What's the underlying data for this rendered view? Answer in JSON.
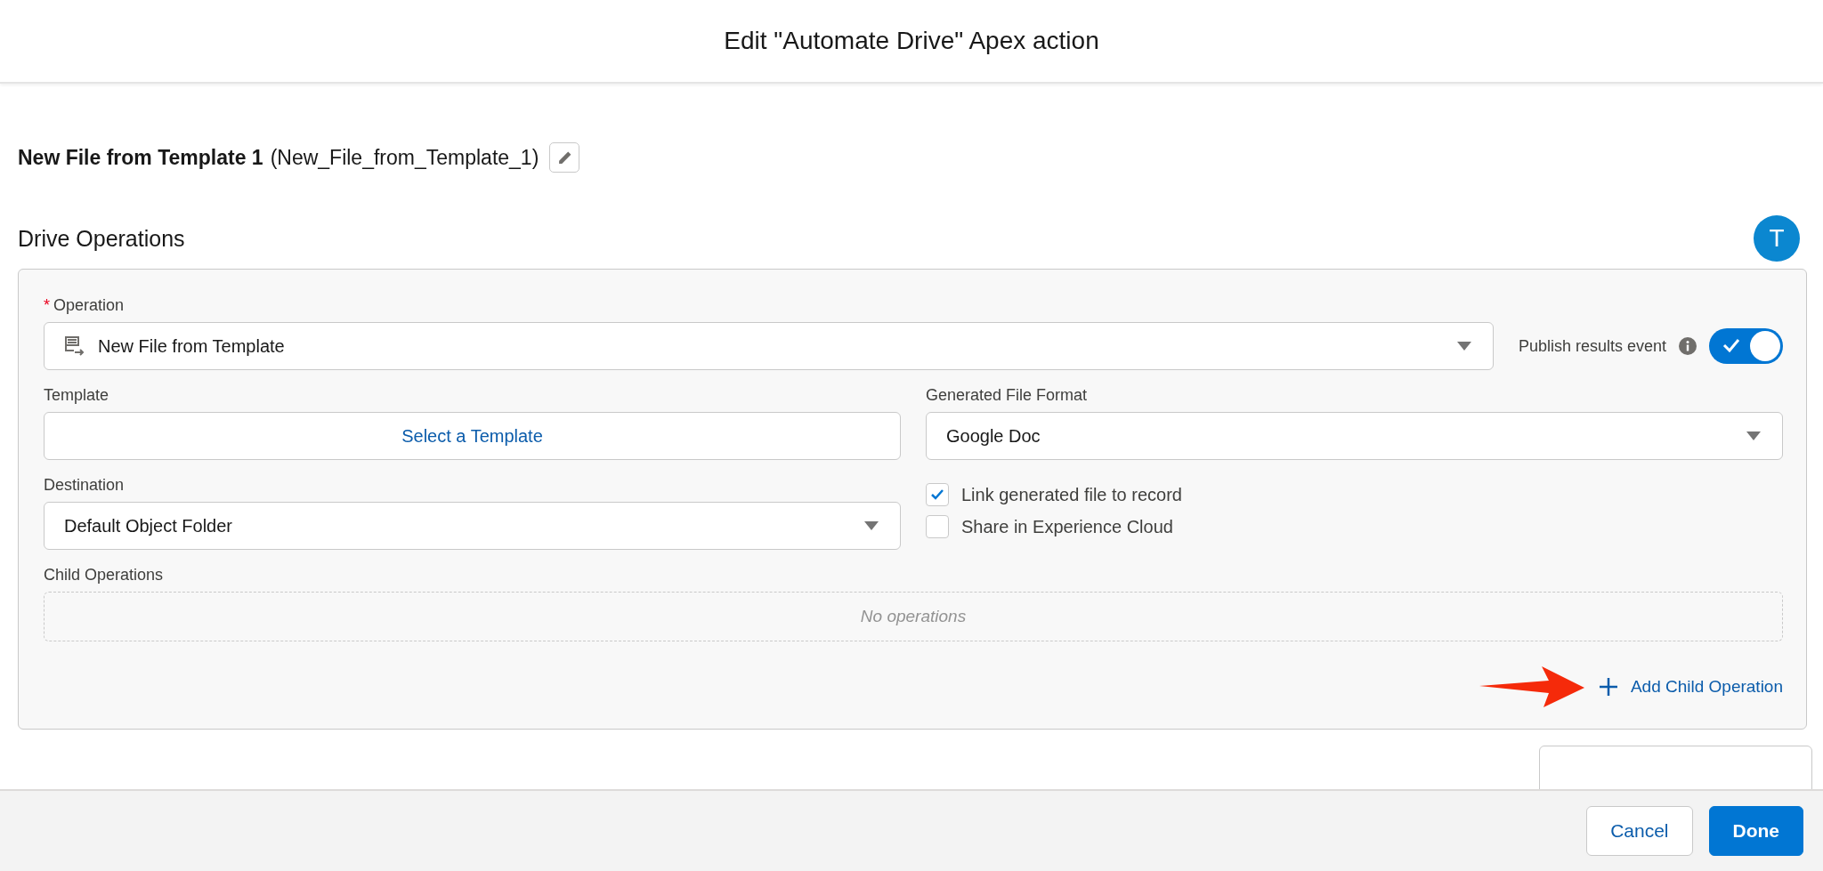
{
  "dialog": {
    "title": "Edit \"Automate Drive\" Apex action"
  },
  "record": {
    "label": "New File from Template 1",
    "api_name": "(New_File_from_Template_1)"
  },
  "section": {
    "title": "Drive Operations",
    "avatar": "T"
  },
  "operation": {
    "label": "Operation",
    "required_mark": "*",
    "value": "New File from Template"
  },
  "publish": {
    "label": "Publish results event",
    "on": true
  },
  "template": {
    "label": "Template",
    "button": "Select a Template"
  },
  "format": {
    "label": "Generated File Format",
    "value": "Google Doc"
  },
  "destination": {
    "label": "Destination",
    "value": "Default Object Folder"
  },
  "options": [
    {
      "label": "Link generated file to record",
      "checked": true
    },
    {
      "label": "Share in Experience Cloud",
      "checked": false
    }
  ],
  "child_operations": {
    "label": "Child Operations",
    "empty_text": "No operations"
  },
  "add_child": "Add Child Operation",
  "buttons": [
    {
      "label": "Cancel",
      "kind": "neutral"
    },
    {
      "label": "Done",
      "kind": "brand"
    }
  ]
}
